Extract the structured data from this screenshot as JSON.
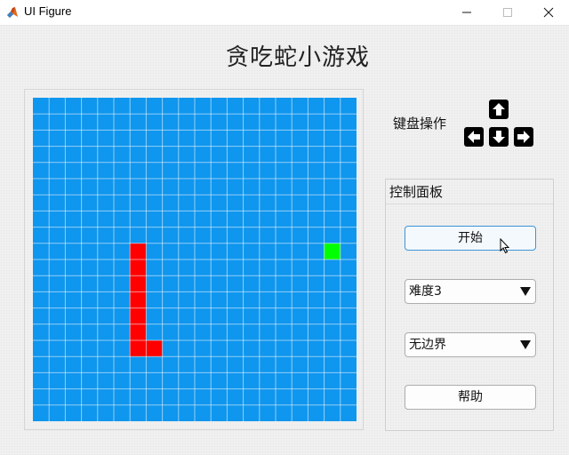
{
  "window": {
    "title": "UI Figure"
  },
  "game": {
    "title": "贪吃蛇小游戏"
  },
  "board": {
    "cols": 20,
    "rows": 20,
    "bg_color": "#0f96ee",
    "snake_color": "#ff0000",
    "food_color": "#00ff00",
    "snake": [
      [
        6,
        9
      ],
      [
        6,
        10
      ],
      [
        6,
        11
      ],
      [
        6,
        12
      ],
      [
        6,
        13
      ],
      [
        6,
        14
      ],
      [
        6,
        15
      ],
      [
        7,
        15
      ]
    ],
    "food": [
      18,
      9
    ]
  },
  "keyboard": {
    "label": "键盘操作",
    "keys": [
      "up-arrow",
      "left-arrow",
      "down-arrow",
      "right-arrow"
    ]
  },
  "control_panel": {
    "title": "控制面板",
    "start_label": "开始",
    "difficulty": "难度3",
    "boundary": "无边界",
    "help_label": "帮助"
  }
}
